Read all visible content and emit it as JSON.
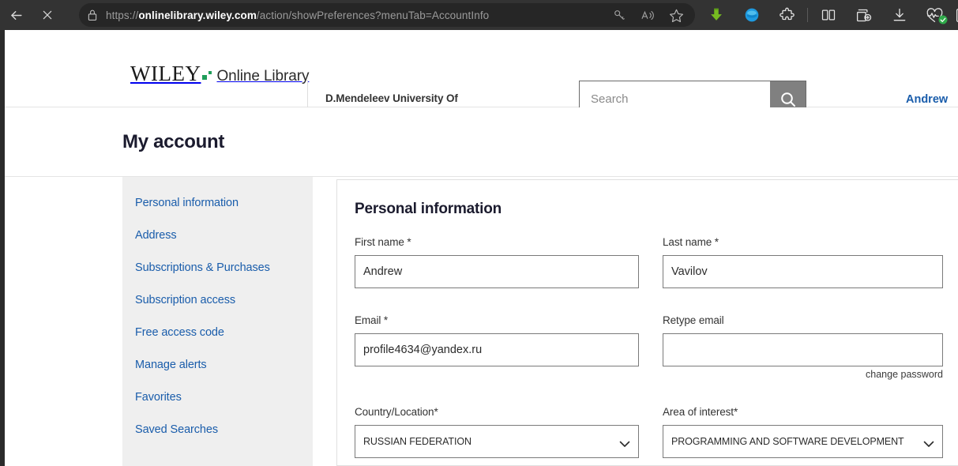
{
  "browser": {
    "back_label": "Back",
    "stop_label": "Stop",
    "url_display_prefix": "https://",
    "url_host": "onlinelibrary.wiley.com",
    "url_path": "/action/showPreferences?menuTab=AccountInfo",
    "url_full": "https://onlinelibrary.wiley.com/action/showPreferences?menuTab=AccountInfo",
    "pill_icons": [
      "key-icon",
      "read-aloud-icon",
      "favorite-star-icon"
    ],
    "toolbar_icons": [
      "green-download-arrow-icon",
      "blue-circle-icon",
      "extensions-puzzle-icon",
      "split-screen-icon",
      "collections-add-icon",
      "downloads-icon",
      "browser-essentials-heartbeat-icon",
      "profile-icon"
    ]
  },
  "header": {
    "logo_word": "WILEY",
    "logo_suffix": "Online Library",
    "institution": "D.Mendeleev University Of",
    "user_name": "Andrew"
  },
  "search": {
    "placeholder": "Search",
    "value": "",
    "button_label": "Search"
  },
  "page": {
    "title": "My account"
  },
  "sidebar": {
    "items": [
      {
        "label": "Personal information"
      },
      {
        "label": "Address"
      },
      {
        "label": "Subscriptions & Purchases"
      },
      {
        "label": "Subscription access"
      },
      {
        "label": "Free access code"
      },
      {
        "label": "Manage alerts"
      },
      {
        "label": "Favorites"
      },
      {
        "label": "Saved Searches"
      }
    ]
  },
  "form": {
    "section_title": "Personal information",
    "first_name": {
      "label": "First name *",
      "value": "Andrew",
      "placeholder": ""
    },
    "last_name": {
      "label": "Last name *",
      "value": "Vavilov",
      "placeholder": ""
    },
    "email": {
      "label": "Email *",
      "value": "profile4634@yandex.ru",
      "placeholder": ""
    },
    "retype_email": {
      "label": "Retype email",
      "value": "",
      "placeholder": ""
    },
    "change_password_label": "change password",
    "country": {
      "label": "Country/Location*",
      "value": "RUSSIAN FEDERATION"
    },
    "area_of_interest": {
      "label": "Area of interest*",
      "value": "PROGRAMMING AND SOFTWARE DEVELOPMENT"
    }
  },
  "colors": {
    "link_blue": "#1a5dab",
    "brand_green": "#1f9e5a",
    "sidebar_gray": "#efefef",
    "search_button_gray": "#808080",
    "chrome_dark": "#333333"
  }
}
